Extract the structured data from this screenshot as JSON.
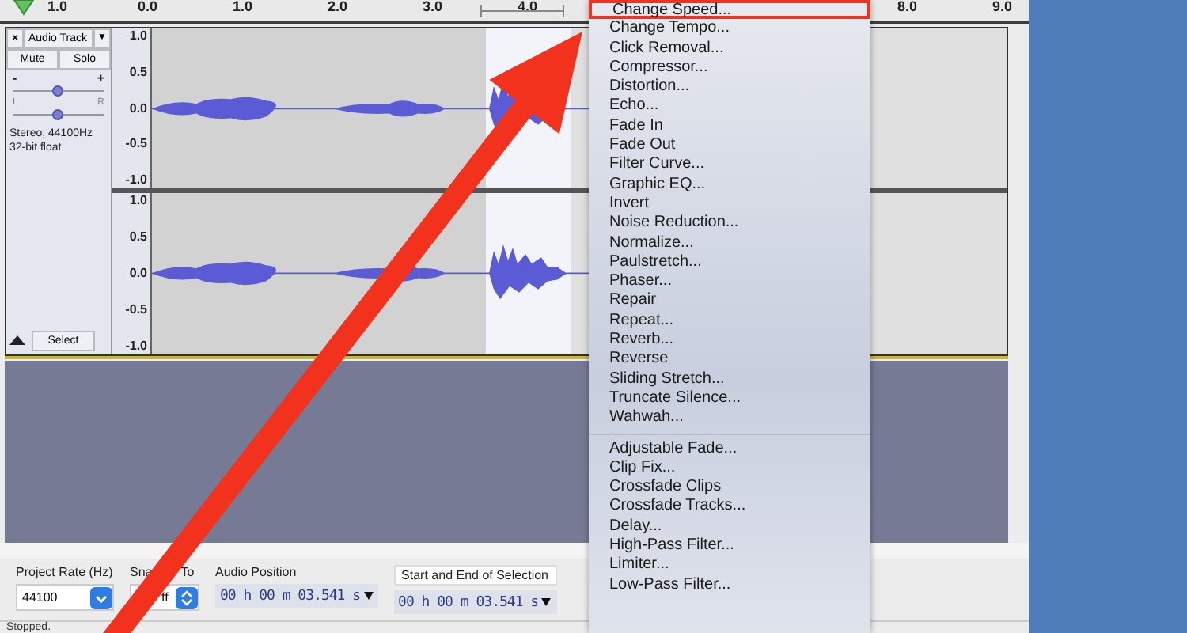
{
  "ruler": {
    "labels": [
      "1.0",
      "0.0",
      "1.0",
      "2.0",
      "3.0",
      "4.0",
      "8.0",
      "9.0"
    ]
  },
  "track": {
    "close": "×",
    "name": "Audio Track",
    "caret": "▼",
    "buttons": [
      "Mute",
      "Solo"
    ],
    "sliders": [
      {
        "kind": "gain",
        "min_label": "-",
        "max_label": "+",
        "level": 0.5
      },
      {
        "kind": "pan",
        "min_label": "L",
        "max_label": "R",
        "level": 0.5
      }
    ],
    "info": [
      "Stereo, 44100Hz",
      "32-bit float"
    ],
    "select_button": "Select"
  },
  "channels": [
    {
      "axis": [
        "1.0",
        "0.5",
        "0.0",
        "-0.5",
        "-1.0"
      ]
    },
    {
      "axis": [
        "1.0",
        "0.5",
        "0.0",
        "-0.5",
        "-1.0"
      ]
    }
  ],
  "menu": {
    "groups": [
      [
        {
          "label": "Change Speed...",
          "highlighted": true
        },
        {
          "label": "Change Tempo...",
          "highlighted": false
        },
        {
          "label": "Click Removal...",
          "highlighted": false
        },
        {
          "label": "Compressor...",
          "highlighted": false
        },
        {
          "label": "Distortion...",
          "highlighted": false
        },
        {
          "label": "Echo...",
          "highlighted": false
        },
        {
          "label": "Fade In",
          "highlighted": false
        },
        {
          "label": "Fade Out",
          "highlighted": false
        },
        {
          "label": "Filter Curve...",
          "highlighted": false
        },
        {
          "label": "Graphic EQ...",
          "highlighted": false
        },
        {
          "label": "Invert",
          "highlighted": false
        },
        {
          "label": "Noise Reduction...",
          "highlighted": false
        },
        {
          "label": "Normalize...",
          "highlighted": false
        },
        {
          "label": "Paulstretch...",
          "highlighted": false
        },
        {
          "label": "Phaser...",
          "highlighted": false
        },
        {
          "label": "Repair",
          "highlighted": false
        },
        {
          "label": "Repeat...",
          "highlighted": false
        },
        {
          "label": "Reverb...",
          "highlighted": false
        },
        {
          "label": "Reverse",
          "highlighted": false
        },
        {
          "label": "Sliding Stretch...",
          "highlighted": false
        },
        {
          "label": "Truncate Silence...",
          "highlighted": false
        },
        {
          "label": "Wahwah...",
          "highlighted": false
        }
      ],
      [
        {
          "label": "Adjustable Fade...",
          "highlighted": false
        },
        {
          "label": "Clip Fix...",
          "highlighted": false
        },
        {
          "label": "Crossfade Clips",
          "highlighted": false
        },
        {
          "label": "Crossfade Tracks...",
          "highlighted": false
        },
        {
          "label": "Delay...",
          "highlighted": false
        },
        {
          "label": "High-Pass Filter...",
          "highlighted": false
        },
        {
          "label": "Limiter...",
          "highlighted": false
        },
        {
          "label": "Low-Pass Filter...",
          "highlighted": false
        }
      ]
    ]
  },
  "toolbar": {
    "project_rate": {
      "label": "Project Rate (Hz)",
      "value": "44100"
    },
    "snap_to": {
      "label_parts": [
        "Sna",
        "To"
      ],
      "value": "ff"
    },
    "audio_position": {
      "label": "Audio Position",
      "value": "00 h 00 m 03.541 s"
    },
    "selection": {
      "label": "Start and End of Selection",
      "value": "00 h 00 m 03.541 s"
    }
  },
  "status_bar": {
    "text": "Stopped."
  }
}
